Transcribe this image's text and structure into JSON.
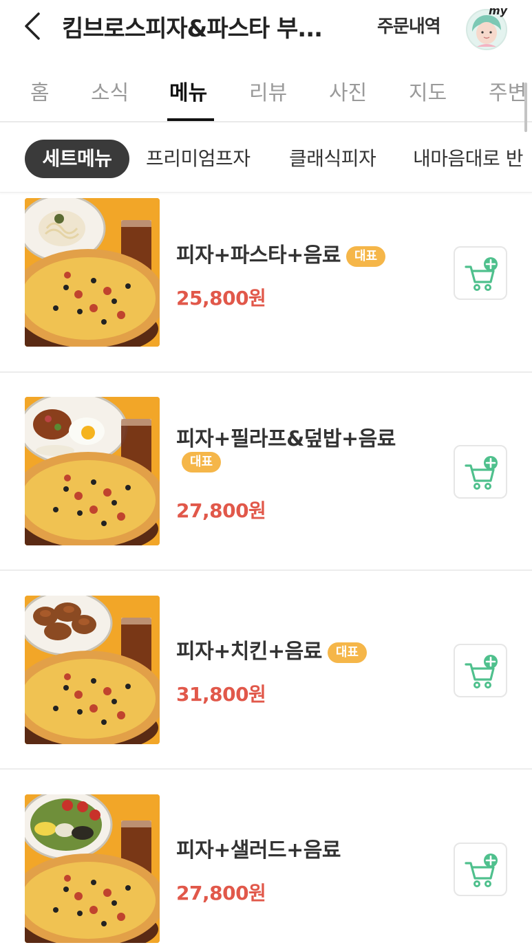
{
  "header": {
    "title": "킴브로스피자&파스타 부...",
    "orders_label": "주문내역",
    "avatar_text": "my"
  },
  "tabs": [
    {
      "label": "홈",
      "active": false
    },
    {
      "label": "소식",
      "active": false
    },
    {
      "label": "메뉴",
      "active": true
    },
    {
      "label": "리뷰",
      "active": false
    },
    {
      "label": "사진",
      "active": false
    },
    {
      "label": "지도",
      "active": false
    },
    {
      "label": "주변",
      "active": false
    }
  ],
  "categories": [
    {
      "label": "세트메뉴",
      "active": true
    },
    {
      "label": "프리미엄프자",
      "active": false
    },
    {
      "label": "클래식피자",
      "active": false
    },
    {
      "label": "내마음대로 반",
      "active": false
    }
  ],
  "menu": [
    {
      "name": "피자+파스타+음료",
      "badge": "대표",
      "price": "25,800원",
      "side": "pasta"
    },
    {
      "name": "피자+필라프&덮밥+음료",
      "badge": "대표",
      "price": "27,800원",
      "side": "pilaf"
    },
    {
      "name": "피자+치킨+음료",
      "badge": "대표",
      "price": "31,800원",
      "side": "chicken"
    },
    {
      "name": "피자+샐러드+음료",
      "badge": "",
      "price": "27,800원",
      "side": "salad"
    }
  ],
  "icons": {
    "back": "chevron-left-icon",
    "cart": "cart-add-icon"
  },
  "colors": {
    "price": "#e1584a",
    "badge": "#f5b649",
    "cart_accent": "#4fc08d",
    "active_chip": "#3a3a3a",
    "thumb_bg": "#f2a628"
  }
}
